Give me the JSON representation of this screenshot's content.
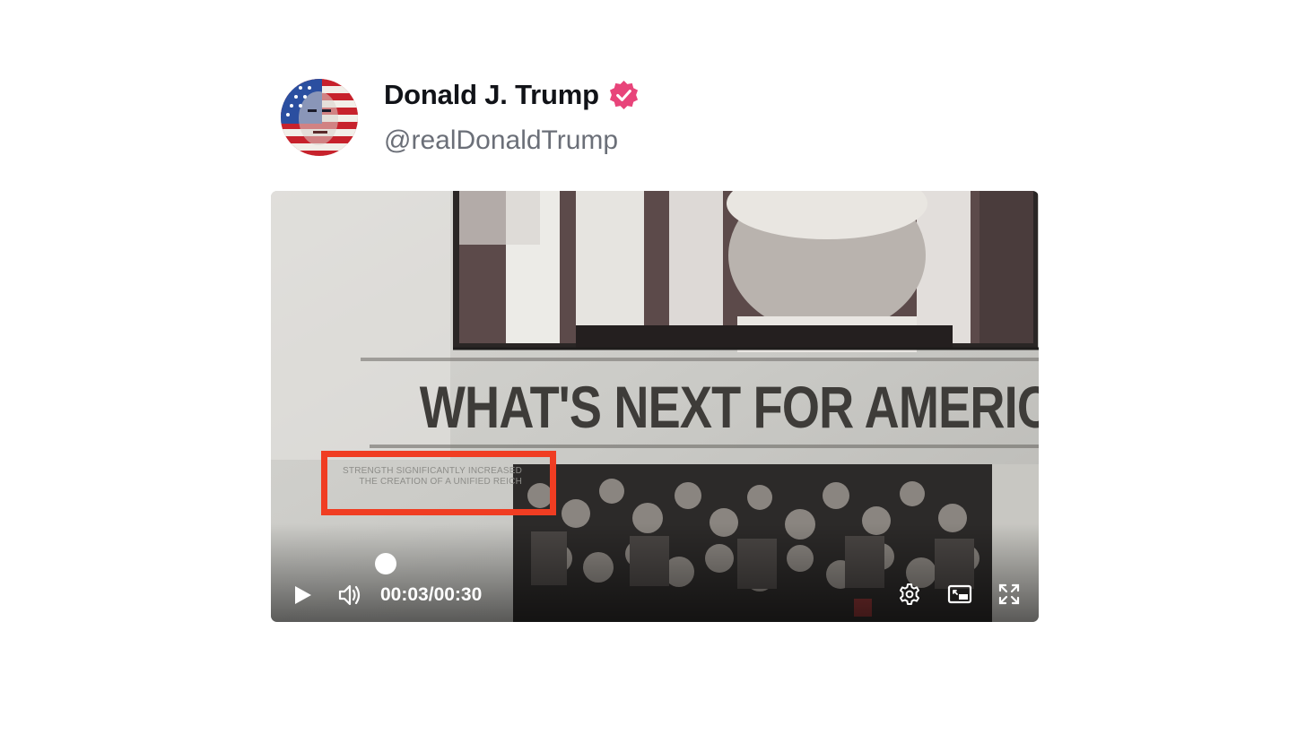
{
  "post": {
    "author": {
      "display_name": "Donald J. Trump",
      "handle": "@realDonaldTrump",
      "verified": true,
      "verified_color": "#e8447a"
    },
    "video": {
      "headline": "WHAT'S NEXT FOR AMERICA?",
      "subtext_lines": [
        "STRENGTH SIGNIFICANTLY INCREASED",
        "THE CREATION OF A UNIFIED REICH"
      ],
      "highlight_color": "#f03d22",
      "current_time": "00:03",
      "duration": "00:30",
      "time_separator": "/",
      "progress_fraction": 0.1,
      "icons": {
        "play": "play-icon",
        "volume": "volume-icon",
        "settings": "gear-icon",
        "pip": "picture-in-picture-icon",
        "fullscreen": "fullscreen-icon"
      }
    }
  }
}
